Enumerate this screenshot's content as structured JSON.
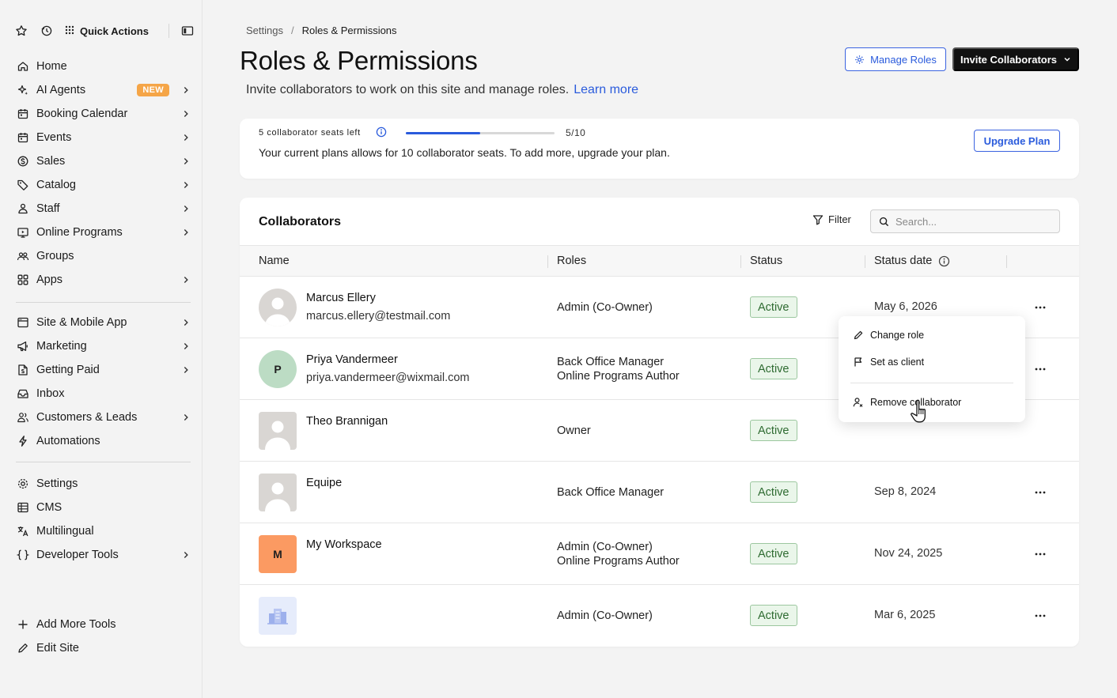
{
  "topbar": {
    "quick_actions": "Quick Actions"
  },
  "sidebar": {
    "group1": [
      {
        "label": "Home",
        "icon": "home-icon",
        "chevron": false
      },
      {
        "label": "AI Agents",
        "icon": "sparkle-icon",
        "chevron": true,
        "badge": "NEW"
      },
      {
        "label": "Booking Calendar",
        "icon": "calendar-icon",
        "chevron": true
      },
      {
        "label": "Events",
        "icon": "calendar-icon",
        "chevron": true
      },
      {
        "label": "Sales",
        "icon": "dollar-icon",
        "chevron": true
      },
      {
        "label": "Catalog",
        "icon": "tag-icon",
        "chevron": true
      },
      {
        "label": "Staff",
        "icon": "staff-icon",
        "chevron": true
      },
      {
        "label": "Online Programs",
        "icon": "programs-icon",
        "chevron": true
      },
      {
        "label": "Groups",
        "icon": "groups-icon",
        "chevron": false
      },
      {
        "label": "Apps",
        "icon": "apps-icon",
        "chevron": true
      }
    ],
    "group2": [
      {
        "label": "Site & Mobile App",
        "icon": "site-icon",
        "chevron": true
      },
      {
        "label": "Marketing",
        "icon": "megaphone-icon",
        "chevron": true
      },
      {
        "label": "Getting Paid",
        "icon": "paid-icon",
        "chevron": true
      },
      {
        "label": "Inbox",
        "icon": "inbox-icon",
        "chevron": false
      },
      {
        "label": "Customers & Leads",
        "icon": "customers-icon",
        "chevron": true
      },
      {
        "label": "Automations",
        "icon": "bolt-icon",
        "chevron": false
      }
    ],
    "group3": [
      {
        "label": "Settings",
        "icon": "gear-icon",
        "chevron": false
      },
      {
        "label": "CMS",
        "icon": "cms-icon",
        "chevron": false
      },
      {
        "label": "Multilingual",
        "icon": "translate-icon",
        "chevron": false
      },
      {
        "label": "Developer Tools",
        "icon": "braces-icon",
        "chevron": true
      }
    ],
    "bottom": [
      {
        "label": "Add More Tools",
        "icon": "plus-icon"
      },
      {
        "label": "Edit Site",
        "icon": "pencil-icon"
      }
    ]
  },
  "breadcrumb": {
    "parent": "Settings",
    "separator": "/",
    "current": "Roles & Permissions"
  },
  "header": {
    "title": "Roles & Permissions",
    "subtitle": "Invite collaborators to work on this site and manage roles.",
    "learn_more": "Learn more",
    "manage_roles": "Manage Roles",
    "invite": "Invite Collaborators"
  },
  "seats": {
    "label": "5 collaborator seats left",
    "used": 5,
    "total": 10,
    "count_text": "5/10",
    "description": "Your current plans allows for 10 collaborator seats. To add more, upgrade your plan.",
    "upgrade": "Upgrade Plan"
  },
  "collaborators": {
    "title": "Collaborators",
    "filter": "Filter",
    "search_placeholder": "Search...",
    "columns": {
      "name": "Name",
      "roles": "Roles",
      "status": "Status",
      "status_date": "Status date"
    },
    "rows": [
      {
        "name": "Marcus Ellery",
        "email": "marcus.ellery@testmail.com",
        "roles": [
          "Admin (Co-Owner)"
        ],
        "status": "Active",
        "date": "May 6, 2026",
        "avatar": "photo-circle"
      },
      {
        "name": "Priya Vandermeer",
        "email": "priya.vandermeer@wixmail.com",
        "roles": [
          "Back Office Manager",
          "Online Programs Author"
        ],
        "status": "Active",
        "date": "",
        "avatar": "initial",
        "initial": "P"
      },
      {
        "name": "Theo Brannigan",
        "email": "",
        "roles": [
          "Owner"
        ],
        "status": "Active",
        "date": "",
        "avatar": "photo-square"
      },
      {
        "name": "Equipe",
        "email": "",
        "roles": [
          "Back Office Manager"
        ],
        "status": "Active",
        "date": "Sep 8, 2024",
        "avatar": "photo-square"
      },
      {
        "name": "My Workspace",
        "email": "",
        "roles": [
          "Admin (Co-Owner)",
          "Online Programs Author"
        ],
        "status": "Active",
        "date": "Nov 24, 2025",
        "avatar": "initial-orange",
        "initial": "M"
      },
      {
        "name": "",
        "email": "",
        "roles": [
          "Admin (Co-Owner)"
        ],
        "status": "Active",
        "date": "Mar 6, 2025",
        "avatar": "building"
      }
    ]
  },
  "context_menu": {
    "change_role": "Change role",
    "set_as_client": "Set as client",
    "remove": "Remove collaborator"
  },
  "colors": {
    "accent": "#2a5bdc",
    "status_bg": "#eaf6ea",
    "status_border": "#9cc79f",
    "new_badge": "#f5a547",
    "avatar_green": "#bcdcc4",
    "avatar_orange": "#fb9a62"
  }
}
